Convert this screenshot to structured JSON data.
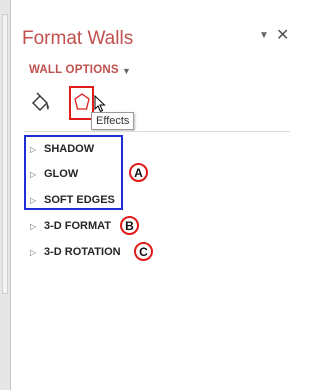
{
  "pane": {
    "title": "Format Walls"
  },
  "wall_options": {
    "label": "WALL OPTIONS"
  },
  "tooltip": {
    "text": "Effects"
  },
  "sections": {
    "shadow": "SHADOW",
    "glow": "GLOW",
    "soft_edges": "SOFT EDGES",
    "format_3d": "3-D FORMAT",
    "rotation_3d": "3-D ROTATION"
  },
  "badges": {
    "a": "A",
    "b": "B",
    "c": "C"
  },
  "colors": {
    "accent": "#c0504d",
    "highlight_red": "#e11a1a",
    "highlight_blue": "#1f2fd1"
  }
}
